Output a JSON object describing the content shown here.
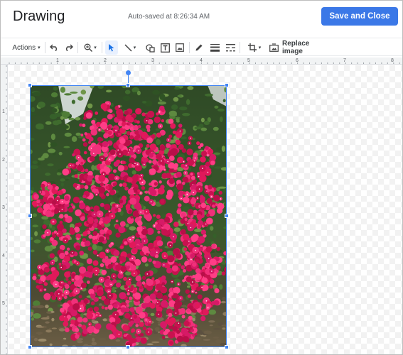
{
  "header": {
    "title": "Drawing",
    "autosave": "Auto-saved at 8:26:34 AM",
    "save_close_label": "Save and Close"
  },
  "toolbar": {
    "actions_label": "Actions",
    "replace_image_label": "Replace image",
    "icons": [
      "undo-icon",
      "redo-icon",
      "zoom-icon",
      "select-icon",
      "line-icon",
      "shape-icon",
      "textbox-icon",
      "image-icon",
      "pen-icon",
      "line-weight-icon",
      "line-dash-icon",
      "crop-icon",
      "reset-image-icon"
    ]
  },
  "ruler": {
    "h_numbers": [
      "1",
      "2",
      "3",
      "4",
      "5",
      "6",
      "7",
      "8"
    ],
    "v_numbers": [
      "1",
      "2",
      "3",
      "4",
      "5"
    ]
  },
  "colors": {
    "accent": "#3b78e7",
    "selection": "#4285f4",
    "flower": "#e0195a"
  },
  "canvas": {
    "image_subject": "bougainvillea photo"
  }
}
